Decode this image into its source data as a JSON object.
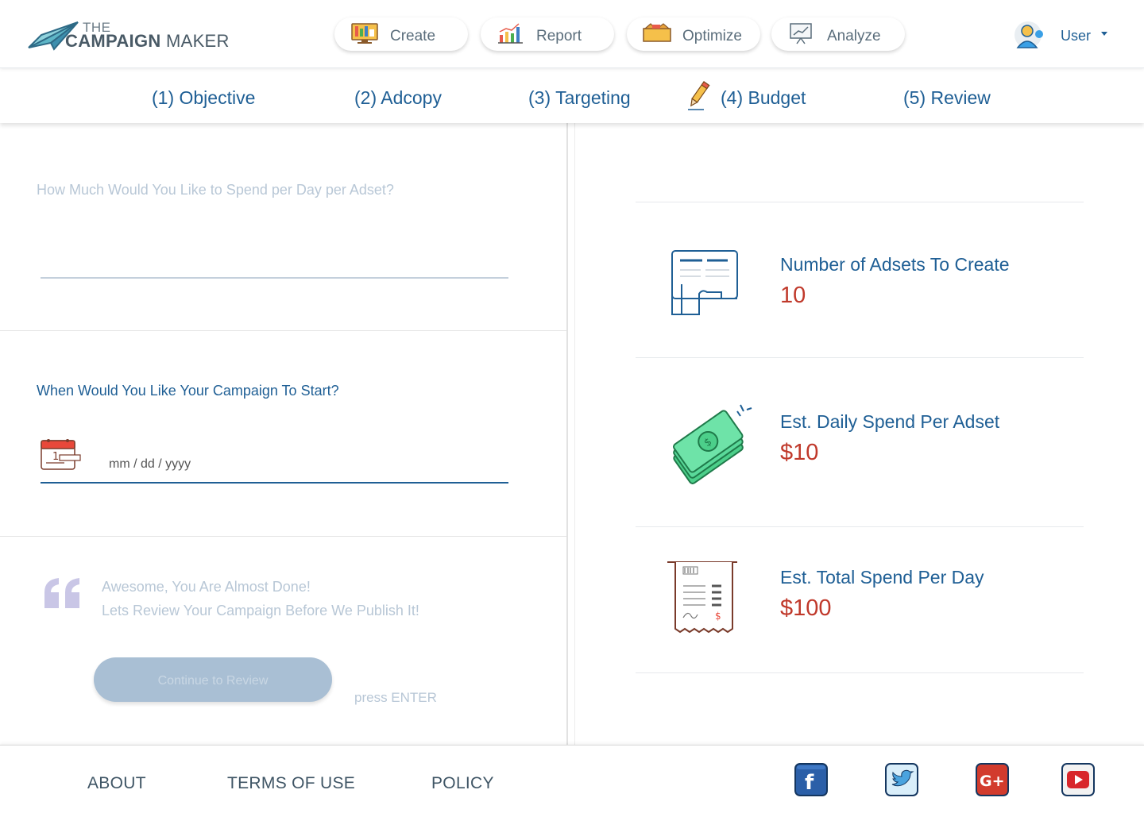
{
  "header": {
    "logo": {
      "the": "THE",
      "campaign": "CAMPAIGN",
      "maker": "MAKER"
    },
    "nav": [
      {
        "label": "Create",
        "icon": "monitor-icon"
      },
      {
        "label": "Report",
        "icon": "bar-chart-icon"
      },
      {
        "label": "Optimize",
        "icon": "toolbox-icon"
      },
      {
        "label": "Analyze",
        "icon": "presentation-icon"
      }
    ],
    "user": {
      "label": "User",
      "icon": "user-avatar-icon"
    }
  },
  "steps": [
    {
      "label": "(1) Objective"
    },
    {
      "label": "(2) Adcopy"
    },
    {
      "label": "(3) Targeting"
    },
    {
      "label": "(4) Budget",
      "active": true
    },
    {
      "label": "(5) Review"
    }
  ],
  "form": {
    "spend_question": "How Much Would You Like to Spend per Day per Adset?",
    "spend_value": "",
    "start_question": "When Would You Like Your Campaign To Start?",
    "date_placeholder": "mm / dd / yyyy",
    "almost_done_line1": "Awesome, You Are Almost Done!",
    "almost_done_line2": "Lets Review Your Campaign Before We Publish It!",
    "continue_label": "Continue to Review",
    "enter_hint": "press ENTER"
  },
  "summary": [
    {
      "label": "Number of Adsets To Create",
      "value": "10",
      "icon": "document-icon"
    },
    {
      "label": "Est. Daily Spend Per Adset",
      "value": "$10",
      "icon": "money-stack-icon"
    },
    {
      "label": "Est. Total Spend Per Day",
      "value": "$100",
      "icon": "receipt-icon"
    }
  ],
  "footer": {
    "links": [
      "ABOUT",
      "TERMS OF USE",
      "POLICY"
    ],
    "social": [
      {
        "name": "facebook",
        "glyph": "f",
        "color": "#2b5fa8"
      },
      {
        "name": "twitter",
        "glyph": "",
        "color": "#4aa3df"
      },
      {
        "name": "google-plus",
        "glyph": "G+",
        "color": "#d23b2d"
      },
      {
        "name": "youtube",
        "glyph": "",
        "color": "#d8262b"
      }
    ]
  },
  "colors": {
    "primary": "#1f5f95",
    "value": "#c0392b",
    "muted": "#b8c7d6",
    "button": "#a9bfd4"
  }
}
